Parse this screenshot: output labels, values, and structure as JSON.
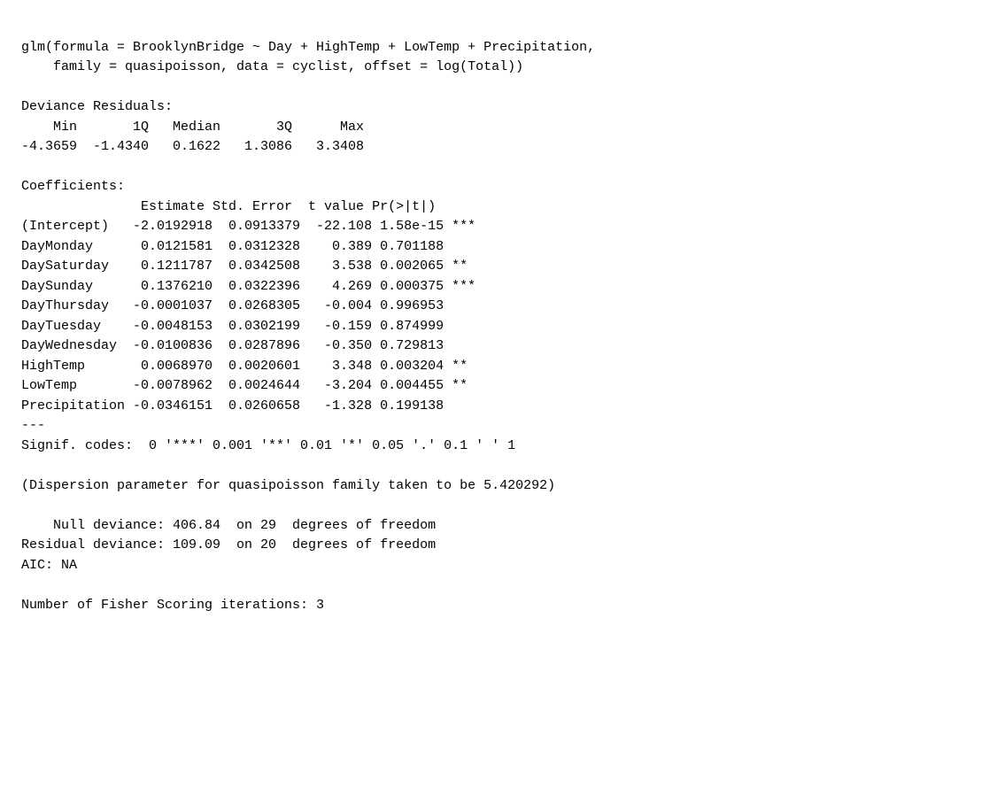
{
  "content": {
    "lines": [
      "glm(formula = BrooklynBridge ~ Day + HighTemp + LowTemp + Precipitation,",
      "    family = quasipoisson, data = cyclist, offset = log(Total))",
      "",
      "Deviance Residuals:",
      "    Min       1Q   Median       3Q      Max",
      "-4.3659  -1.4340   0.1622   1.3086   3.3408",
      "",
      "Coefficients:",
      "               Estimate Std. Error  t value Pr(>|t|)    ",
      "(Intercept)   -2.0192918  0.0913379  -22.108 1.58e-15 ***",
      "DayMonday      0.0121581  0.0312328    0.389 0.701188    ",
      "DaySaturday    0.1211787  0.0342508    3.538 0.002065 ** ",
      "DaySunday      0.1376210  0.0322396    4.269 0.000375 ***",
      "DayThursday   -0.0001037  0.0268305   -0.004 0.996953    ",
      "DayTuesday    -0.0048153  0.0302199   -0.159 0.874999    ",
      "DayWednesday  -0.0100836  0.0287896   -0.350 0.729813    ",
      "HighTemp       0.0068970  0.0020601    3.348 0.003204 ** ",
      "LowTemp       -0.0078962  0.0024644   -3.204 0.004455 ** ",
      "Precipitation -0.0346151  0.0260658   -1.328 0.199138    ",
      "---",
      "Signif. codes:  0 '***' 0.001 '**' 0.01 '*' 0.05 '.' 0.1 ' ' 1",
      "",
      "(Dispersion parameter for quasipoisson family taken to be 5.420292)",
      "",
      "    Null deviance: 406.84  on 29  degrees of freedom",
      "Residual deviance: 109.09  on 20  degrees of freedom",
      "AIC: NA",
      "",
      "Number of Fisher Scoring iterations: 3"
    ]
  }
}
